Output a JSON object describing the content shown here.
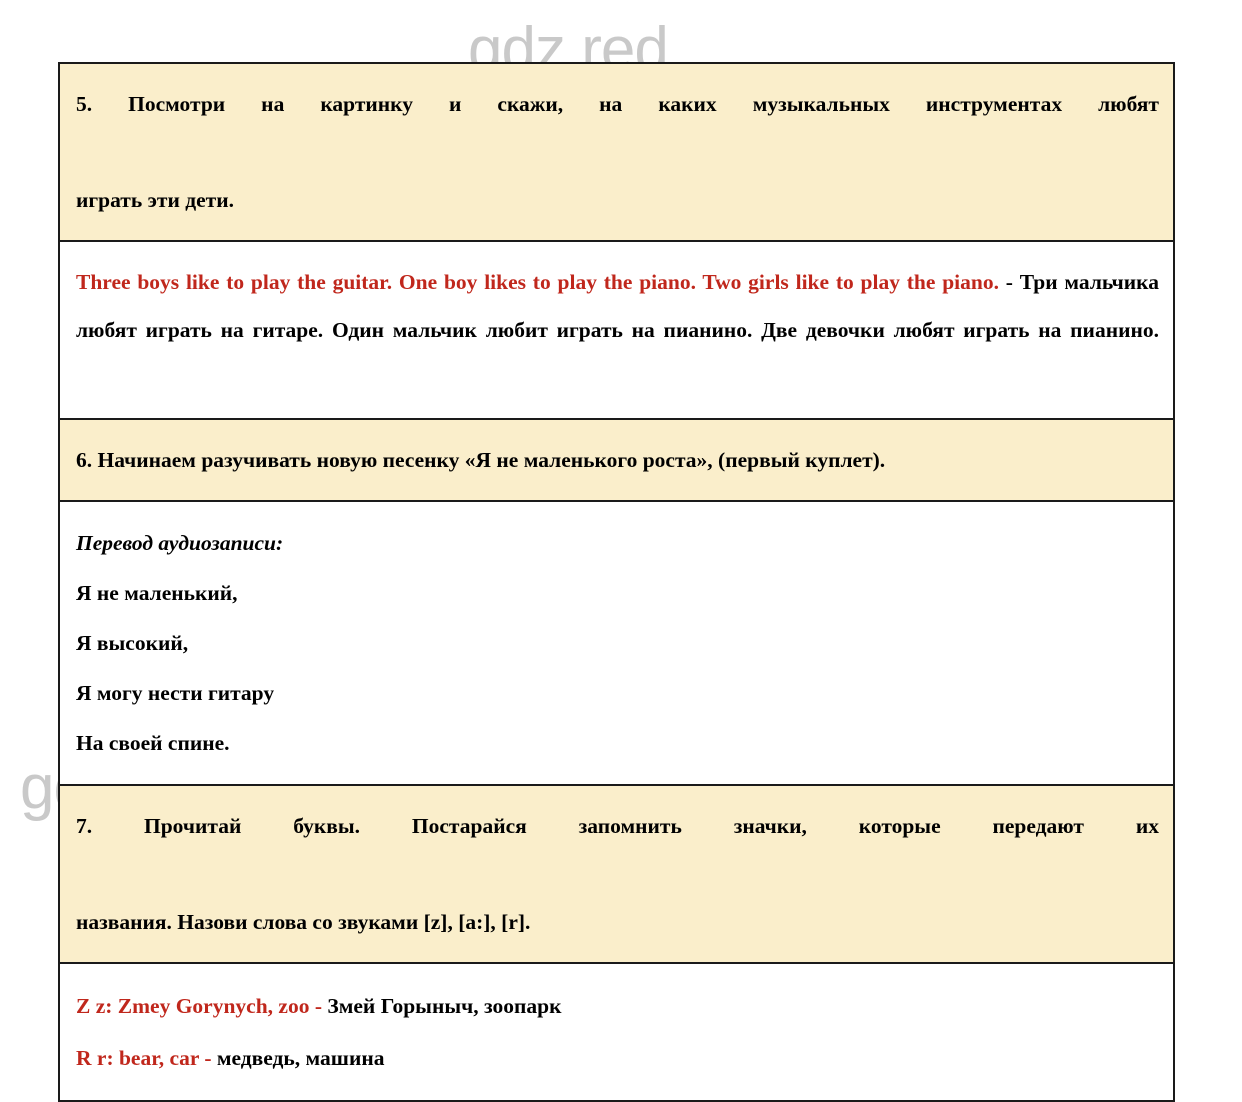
{
  "watermark": {
    "text": "gdz.red",
    "color": "#c9c9c9",
    "occurrences": 4
  },
  "colors": {
    "cream_background": "#faeecb",
    "white_background": "#ffffff",
    "border": "#1a1a1a",
    "red_text": "#c0271c",
    "black_text": "#000000"
  },
  "exercises": [
    {
      "number": "5",
      "task": {
        "line1": "5. Посмотри на картинку и скажи, на каких музыкальных инструментах любят",
        "line2": "играть эти дети."
      },
      "answer": {
        "english": "Three boys like to play the guitar. One boy likes to play the piano. Two girls like to play the piano.",
        "separator": " - ",
        "russian": "Три мальчика любят играть на гитаре. Один мальчик любит играть на пианино. Две девочки любят играть на пианино."
      }
    },
    {
      "number": "6",
      "task": {
        "line1": "6. Начинаем разучивать новую песенку «Я не маленького роста», (первый куплет)."
      },
      "answer": {
        "heading": "Перевод аудиозаписи:",
        "song_lines": [
          "Я не маленький,",
          "Я высокий,",
          "Я могу нести гитару",
          "На своей спине."
        ]
      }
    },
    {
      "number": "7",
      "task": {
        "line1": "7. Прочитай буквы. Постарайся запомнить значки, которые передают их",
        "line2": "названия. Назови слова со звуками [z], [a:], [r]."
      },
      "answer": {
        "entries": [
          {
            "english": "Z z: Zmey Gorynych, zoo -",
            "russian": "Змей Горыныч, зоопарк"
          },
          {
            "english": "R r: bear, car -",
            "russian": "медведь, машина"
          }
        ]
      }
    }
  ]
}
